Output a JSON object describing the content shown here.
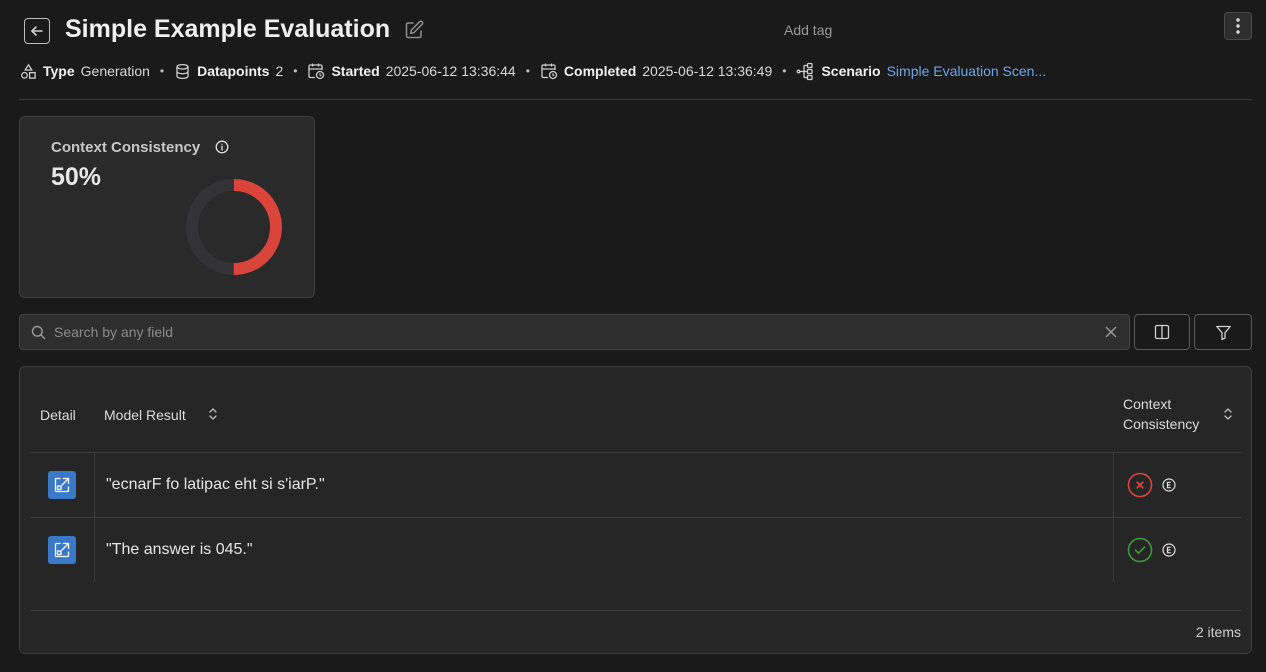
{
  "header": {
    "title": "Simple Example Evaluation",
    "add_tag": "Add tag"
  },
  "meta": {
    "type_label": "Type",
    "type_value": "Generation",
    "datapoints_label": "Datapoints",
    "datapoints_value": "2",
    "started_label": "Started",
    "started_value": "2025-06-12 13:36:44",
    "completed_label": "Completed",
    "completed_value": "2025-06-12 13:36:49",
    "scenario_label": "Scenario",
    "scenario_value": "Simple Evaluation Scen...",
    "separator": "•"
  },
  "metric": {
    "label": "Context Consistency",
    "value": "50%",
    "fraction": 0.5,
    "fill_color": "#d9453a",
    "track_color": "#343438"
  },
  "search": {
    "placeholder": "Search by any field"
  },
  "table": {
    "headers": {
      "detail": "Detail",
      "model_result": "Model Result",
      "context_line1": "Context",
      "context_line2": "Consistency"
    },
    "rows": [
      {
        "result": "\"ecnarF fo latipac eht si s'iarP.\"",
        "status": "fail",
        "status_icon": "x-circle-icon"
      },
      {
        "result": "\"The answer is 045.\"",
        "status": "pass",
        "status_icon": "check-circle-icon"
      }
    ],
    "item_count": "2 items"
  },
  "colors": {
    "accent": "#3a78c8",
    "link": "#6aa6e8",
    "fail": "#d9453a",
    "pass": "#3d9a3a"
  }
}
